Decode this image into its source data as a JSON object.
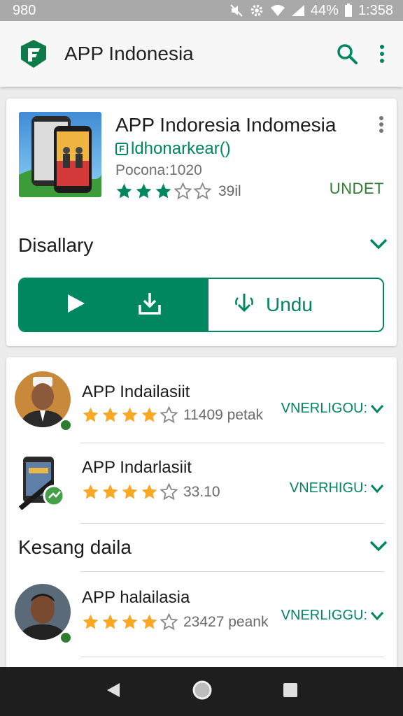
{
  "status_bar": {
    "left_text": "980",
    "battery": "44%",
    "time": "1:358"
  },
  "app_bar": {
    "title": "APP Indonesia",
    "logo_icon": "shield-logo",
    "search_icon": "search-icon",
    "menu_icon": "more-vert-icon"
  },
  "featured": {
    "name": "APP Indoresia Indomesia",
    "developer": "ldhonarkear()",
    "meta": "Pocona:1020",
    "stars": 3,
    "rating_count": "39il",
    "badge": "UNDET",
    "section_label": "Disallary",
    "action_label": "Undu"
  },
  "list": {
    "items": [
      {
        "title": "APP Indailasiit",
        "stars": 4,
        "count": "11409 petak",
        "badge": "VNERLIGOU:"
      },
      {
        "title": "APP Indarlasiit",
        "stars": 4,
        "count": "33.10",
        "badge": "VNERHIGU:"
      },
      {
        "title": "APP halailasia",
        "stars": 4,
        "count": "23427 peank",
        "badge": "VNERLIGGU:"
      }
    ],
    "section_label": "Kesang daila"
  },
  "colors": {
    "accent": "#01875f",
    "star_gold": "#f9a825",
    "star_green": "#01875f"
  }
}
